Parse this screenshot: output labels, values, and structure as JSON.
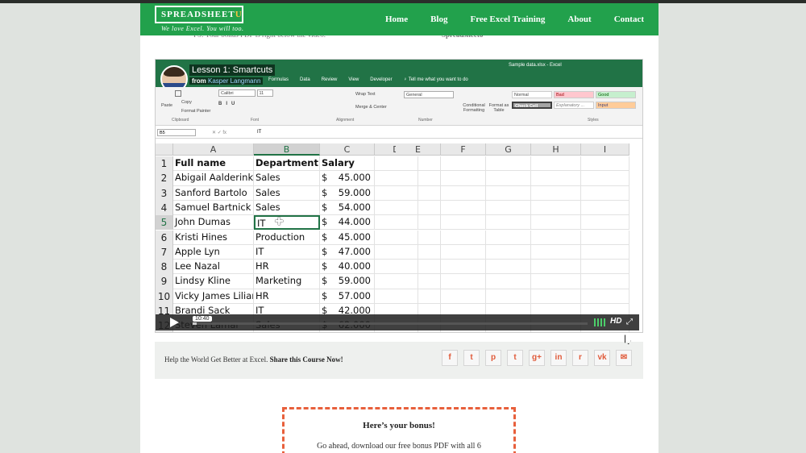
{
  "site": {
    "logo_text": "SPREADSHEET",
    "logo_accent": "U",
    "tagline": "We love Excel. You will too.",
    "ghost_text": "PS: Your bonus PDF is right below the video.",
    "ghost_text2": "Spreadsheeto",
    "brand_color": "#22a14c",
    "accent_color": "#e8603c"
  },
  "nav": {
    "items": [
      "Home",
      "Blog",
      "Free Excel Training",
      "About",
      "Contact"
    ]
  },
  "video": {
    "title": "Lesson 1: Smartcuts",
    "from_label": "from",
    "author": "Kasper Langmann",
    "window_title": "Sample data.xlsx - Excel",
    "tabs": [
      "Formulas",
      "Data",
      "Review",
      "View",
      "Developer",
      "♀ Tell me what you want to do"
    ],
    "ribbon": {
      "paste": "Paste",
      "copy": "Copy",
      "format_painter": "Format Painter",
      "clipboard": "Clipboard",
      "font_name": "Calibri",
      "font_size": "11",
      "font_group": "Font",
      "wrap_text": "Wrap Text",
      "merge_center": "Merge & Center",
      "alignment_group": "Alignment",
      "number_format": "General",
      "number_group": "Number",
      "conditional_formatting": "Conditional Formatting",
      "format_as_table": "Format as Table",
      "styles_group": "Styles",
      "style_normal": "Normal",
      "style_bad": "Bad",
      "style_good": "Good",
      "style_check": "Check Cell",
      "style_explanatory": "Explanatory ...",
      "style_input": "Input"
    },
    "name_box": "B5",
    "formula_value": "IT",
    "columns": [
      "A",
      "B",
      "C",
      "D",
      "E",
      "F",
      "G",
      "H",
      "I"
    ],
    "rows": [
      {
        "n": "1",
        "a": "Full name",
        "b": "Department",
        "c_sym": "",
        "c": "Salary"
      },
      {
        "n": "2",
        "a": "Abigail Aalderink",
        "b": "Sales",
        "c_sym": "$",
        "c": "45.000"
      },
      {
        "n": "3",
        "a": "Sanford Bartolo",
        "b": "Sales",
        "c_sym": "$",
        "c": "59.000"
      },
      {
        "n": "4",
        "a": "Samuel Bartnick",
        "b": "Sales",
        "c_sym": "$",
        "c": "54.000"
      },
      {
        "n": "5",
        "a": "John Dumas",
        "b": "IT",
        "c_sym": "$",
        "c": "44.000"
      },
      {
        "n": "6",
        "a": "Kristi Hines",
        "b": "Production",
        "c_sym": "$",
        "c": "45.000"
      },
      {
        "n": "7",
        "a": "Apple Lyn",
        "b": "IT",
        "c_sym": "$",
        "c": "47.000"
      },
      {
        "n": "8",
        "a": "Lee Nazal",
        "b": "HR",
        "c_sym": "$",
        "c": "40.000"
      },
      {
        "n": "9",
        "a": "Lindsy Kline",
        "b": "Marketing",
        "c_sym": "$",
        "c": "59.000"
      },
      {
        "n": "10",
        "a": "Vicky James Lilian Sa",
        "b": "HR",
        "c_sym": "$",
        "c": "57.000"
      },
      {
        "n": "11",
        "a": "Brandi Sack",
        "b": "IT",
        "c_sym": "$",
        "c": "42.000"
      },
      {
        "n": "12",
        "a": "Steven Lamar",
        "b": "Sales",
        "c_sym": "$",
        "c": "62.000"
      }
    ],
    "player": {
      "timecode": "10:40",
      "progress": 0.01,
      "quality": "HD"
    }
  },
  "share": {
    "text": "Help the World Get Better at Excel.",
    "cta": "Share this Course Now!",
    "icons": [
      {
        "name": "facebook-icon",
        "glyph": "f"
      },
      {
        "name": "twitter-icon",
        "glyph": "t"
      },
      {
        "name": "pinterest-icon",
        "glyph": "p"
      },
      {
        "name": "tumblr-icon",
        "glyph": "t"
      },
      {
        "name": "google-plus-icon",
        "glyph": "g+"
      },
      {
        "name": "linkedin-icon",
        "glyph": "in"
      },
      {
        "name": "reddit-icon",
        "glyph": "r"
      },
      {
        "name": "vk-icon",
        "glyph": "vk"
      },
      {
        "name": "email-icon",
        "glyph": "✉"
      }
    ]
  },
  "bonus": {
    "heading": "Here’s your bonus!",
    "body": "Go ahead, download our free bonus PDF with all 6"
  }
}
